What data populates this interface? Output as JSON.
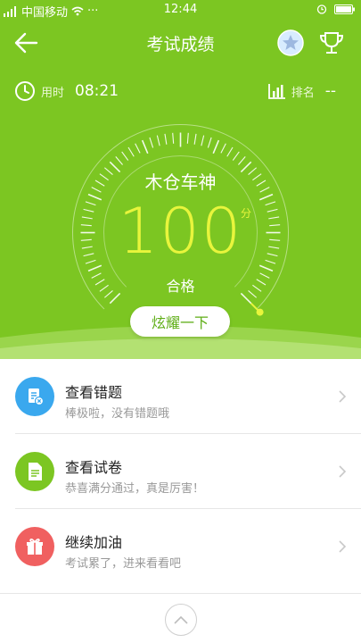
{
  "status_bar": {
    "carrier": "中国移动",
    "more": "···",
    "time": "12:44"
  },
  "nav": {
    "title": "考试成绩"
  },
  "stats": {
    "time_label": "用时",
    "time_value": "08:21",
    "rank_label": "排名",
    "rank_value": "--"
  },
  "gauge": {
    "name": "木仓车神",
    "score": "100",
    "unit": "分",
    "result": "合格",
    "level": 1.0
  },
  "share_button": "炫耀一下",
  "list": [
    {
      "title": "查看错题",
      "subtitle": "棒极啦，没有错题哦",
      "icon": "wrong-questions-icon",
      "color": "#3aa8ee"
    },
    {
      "title": "查看试卷",
      "subtitle": "恭喜满分通过，真是厉害！",
      "icon": "document-icon",
      "color": "#7cc622"
    },
    {
      "title": "继续加油",
      "subtitle": "考试累了，进来看看吧",
      "icon": "gift-icon",
      "color": "#f06060"
    }
  ],
  "colors": {
    "hero": "#7cc622",
    "score": "#e8f53c",
    "button_text": "#5fae17"
  }
}
